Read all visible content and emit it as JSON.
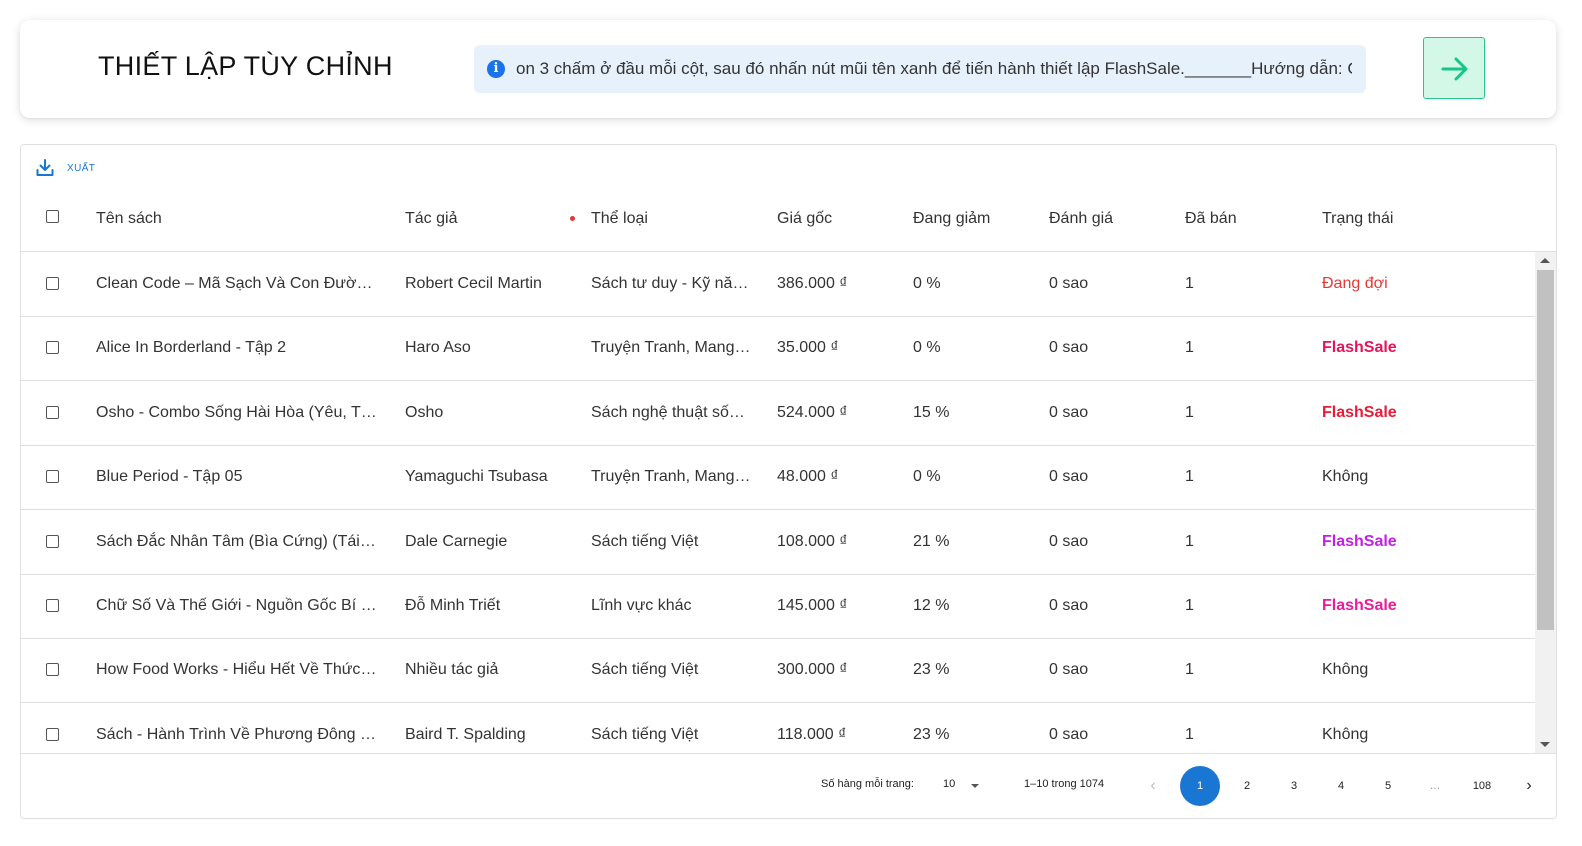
{
  "header": {
    "title": "THIẾT LẬP TÙY CHỈNH",
    "notice": "on 3 chấm ở đầu mỗi cột, sau đó nhấn nút mũi tên xanh để tiến hành thiết lập FlashSale._______Hướng dẫn: C",
    "info_icon": "info-icon",
    "next_icon": "arrow-right-icon"
  },
  "toolbar": {
    "export_label": "XUẤT",
    "export_icon": "download-icon"
  },
  "columns": [
    "Tên sách",
    "Tác giả",
    "Thể loại",
    "Giá gốc",
    "Đang giảm",
    "Đánh giá",
    "Đã bán",
    "Trạng thái"
  ],
  "rows": [
    {
      "title": "Clean Code – Mã Sạch Và Con Đường Trở Thành Lập Trình Viên Giỏi",
      "author": "Robert Cecil Martin",
      "category": "Sách tư duy - Kỹ năng sống",
      "price": "386.000 ₫",
      "discount": "0 %",
      "rating": "0 sao",
      "sold": "1",
      "status": "Đang đợi"
    },
    {
      "title": "Alice In Borderland - Tập 2",
      "author": "Haro Aso",
      "category": "Truyện Tranh, Manga, Comic",
      "price": "35.000 ₫",
      "discount": "0 %",
      "rating": "0 sao",
      "sold": "1",
      "status": "FlashSale"
    },
    {
      "title": "Osho - Combo Sống Hài Hòa (Yêu, Tự Do, Trưởng Thành)",
      "author": "Osho",
      "category": "Sách nghệ thuật sống đẹp",
      "price": "524.000 ₫",
      "discount": "15 %",
      "rating": "0 sao",
      "sold": "1",
      "status": "FlashSale"
    },
    {
      "title": "Blue Period - Tập 05",
      "author": "Yamaguchi Tsubasa",
      "category": "Truyện Tranh, Manga, Comic",
      "price": "48.000 ₫",
      "discount": "0 %",
      "rating": "0 sao",
      "sold": "1",
      "status": "Không"
    },
    {
      "title": "Sách Đắc Nhân Tâm (Bìa Cứng) (Tái Bản)",
      "author": "Dale Carnegie",
      "category": "Sách tiếng Việt",
      "price": "108.000 ₫",
      "discount": "21 %",
      "rating": "0 sao",
      "sold": "1",
      "status": "FlashSale"
    },
    {
      "title": "Chữ Số Và Thế Giới - Nguồn Gốc Bí Ẩn Của Các Con Số",
      "author": "Đỗ Minh Triết",
      "category": "Lĩnh vực khác",
      "price": "145.000 ₫",
      "discount": "12 %",
      "rating": "0 sao",
      "sold": "1",
      "status": "FlashSale"
    },
    {
      "title": "How Food Works - Hiểu Hết Về Thức Ăn",
      "author": "Nhiều tác giả",
      "category": "Sách tiếng Việt",
      "price": "300.000 ₫",
      "discount": "23 %",
      "rating": "0 sao",
      "sold": "1",
      "status": "Không"
    },
    {
      "title": "Sách - Hành Trình Về Phương Đông (Tái Bản)",
      "author": "Baird T. Spalding",
      "category": "Sách tiếng Việt",
      "price": "118.000 ₫",
      "discount": "23 %",
      "rating": "0 sao",
      "sold": "1",
      "status": "Không"
    }
  ],
  "status_colors": [
    "#e53935",
    "#e5155a",
    "#e81c38",
    "#333333",
    "#c21fe8",
    "#e81c9c",
    "#333333",
    "#333333"
  ],
  "pagination": {
    "rows_per_page_label": "Số hàng mỗi trang:",
    "rows_per_page": "10",
    "range": "1–10 trong 1074",
    "prev": "‹",
    "next": "›",
    "pages": [
      "1",
      "2",
      "3",
      "4",
      "5",
      "…",
      "108"
    ],
    "current": "1"
  },
  "colors": {
    "accent": "#1976d2",
    "next_button_bg": "#d3f8e8",
    "next_button_border": "#2cc58e",
    "notice_bg": "#e7f1fc"
  }
}
